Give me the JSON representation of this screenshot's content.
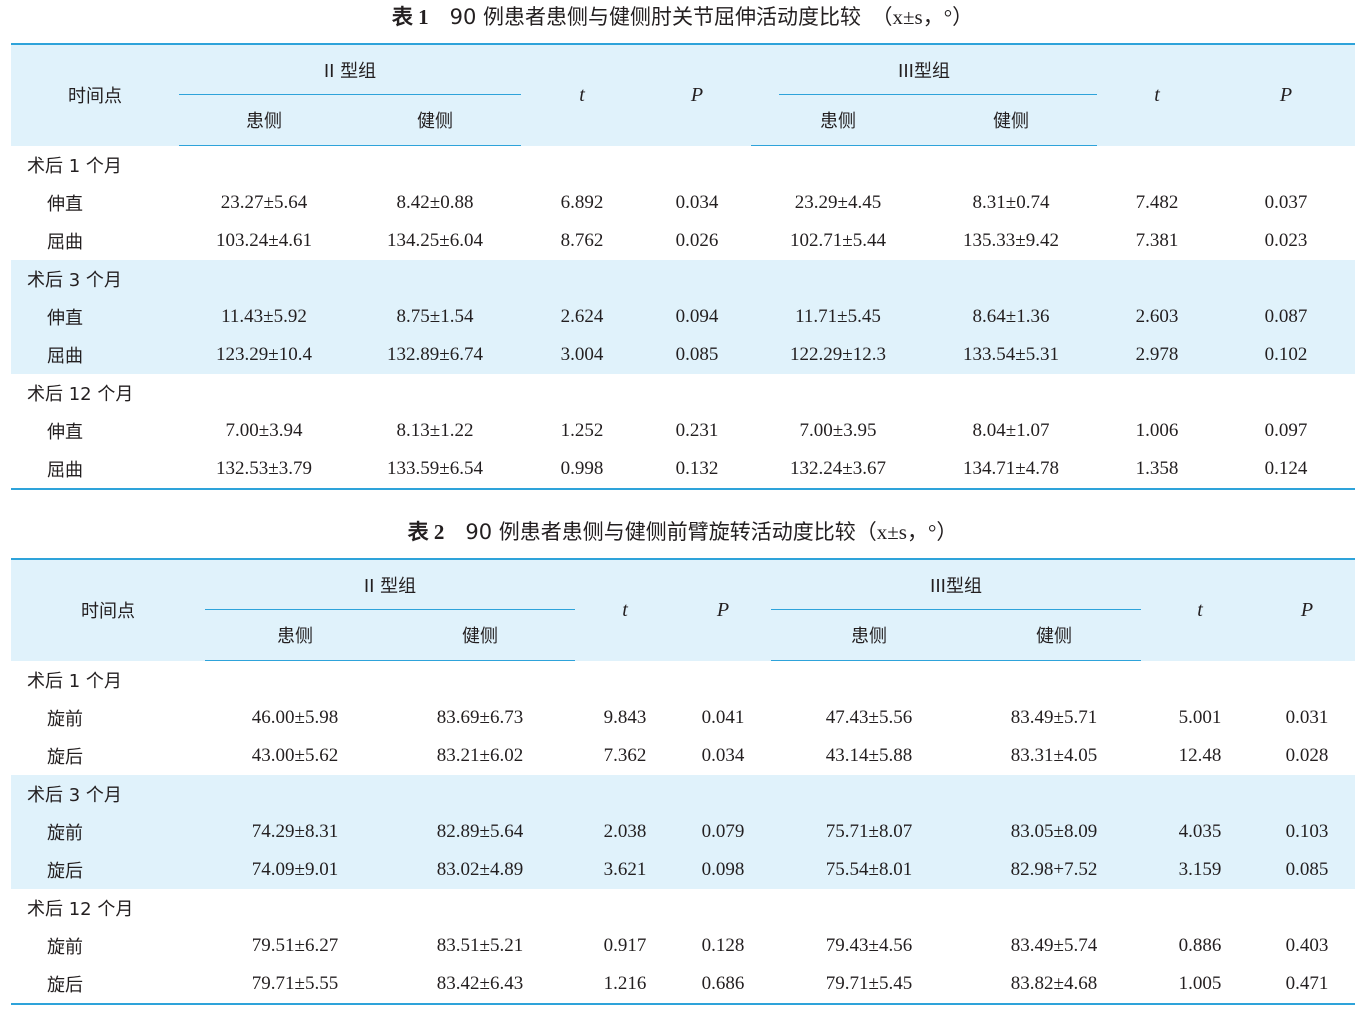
{
  "table1": {
    "caption_num": "表 1",
    "caption_title": "90 例患者患侧与健侧肘关节屈伸活动度比较",
    "caption_unit": "（x±s，°）",
    "header": {
      "time_point": "时间点",
      "group2": "II 型组",
      "group3": "III型组",
      "affected": "患侧",
      "healthy": "健侧",
      "t": "t",
      "p": "P"
    },
    "sections": [
      {
        "label": "术后 1 个月",
        "rows": [
          {
            "label": "伸直",
            "values": [
              "23.27±5.64",
              "8.42±0.88",
              "6.892",
              "0.034",
              "23.29±4.45",
              "8.31±0.74",
              "7.482",
              "0.037"
            ]
          },
          {
            "label": "屈曲",
            "values": [
              "103.24±4.61",
              "134.25±6.04",
              "8.762",
              "0.026",
              "102.71±5.44",
              "135.33±9.42",
              "7.381",
              "0.023"
            ]
          }
        ]
      },
      {
        "label": "术后 3 个月",
        "rows": [
          {
            "label": "伸直",
            "values": [
              "11.43±5.92",
              "8.75±1.54",
              "2.624",
              "0.094",
              "11.71±5.45",
              "8.64±1.36",
              "2.603",
              "0.087"
            ]
          },
          {
            "label": "屈曲",
            "values": [
              "123.29±10.4",
              "132.89±6.74",
              "3.004",
              "0.085",
              "122.29±12.3",
              "133.54±5.31",
              "2.978",
              "0.102"
            ]
          }
        ]
      },
      {
        "label": "术后 12 个月",
        "rows": [
          {
            "label": "伸直",
            "values": [
              "7.00±3.94",
              "8.13±1.22",
              "1.252",
              "0.231",
              "7.00±3.95",
              "8.04±1.07",
              "1.006",
              "0.097"
            ]
          },
          {
            "label": "屈曲",
            "values": [
              "132.53±3.79",
              "133.59±6.54",
              "0.998",
              "0.132",
              "132.24±3.67",
              "134.71±4.78",
              "1.358",
              "0.124"
            ]
          }
        ]
      }
    ]
  },
  "table2": {
    "caption_num": "表 2",
    "caption_title": "90 例患者患侧与健侧前臂旋转活动度比较",
    "caption_unit": "（x±s，°）",
    "header": {
      "time_point": "时间点",
      "group2": "II 型组",
      "group3": "III型组",
      "affected": "患侧",
      "healthy": "健侧",
      "t": "t",
      "p": "P"
    },
    "sections": [
      {
        "label": "术后 1 个月",
        "rows": [
          {
            "label": "旋前",
            "values": [
              "46.00±5.98",
              "83.69±6.73",
              "9.843",
              "0.041",
              "47.43±5.56",
              "83.49±5.71",
              "5.001",
              "0.031"
            ]
          },
          {
            "label": "旋后",
            "values": [
              "43.00±5.62",
              "83.21±6.02",
              "7.362",
              "0.034",
              "43.14±5.88",
              "83.31±4.05",
              "12.48",
              "0.028"
            ]
          }
        ]
      },
      {
        "label": "术后 3 个月",
        "rows": [
          {
            "label": "旋前",
            "values": [
              "74.29±8.31",
              "82.89±5.64",
              "2.038",
              "0.079",
              "75.71±8.07",
              "83.05±8.09",
              "4.035",
              "0.103"
            ]
          },
          {
            "label": "旋后",
            "values": [
              "74.09±9.01",
              "83.02±4.89",
              "3.621",
              "0.098",
              "75.54±8.01",
              "82.98+7.52",
              "3.159",
              "0.085"
            ]
          }
        ]
      },
      {
        "label": "术后 12 个月",
        "rows": [
          {
            "label": "旋前",
            "values": [
              "79.51±6.27",
              "83.51±5.21",
              "0.917",
              "0.128",
              "79.43±4.56",
              "83.49±5.74",
              "0.886",
              "0.403"
            ]
          },
          {
            "label": "旋后",
            "values": [
              "79.71±5.55",
              "83.42±6.43",
              "1.216",
              "0.686",
              "79.71±5.45",
              "83.82±4.68",
              "1.005",
              "0.471"
            ]
          }
        ]
      }
    ]
  },
  "colors": {
    "rule": "#2ea3da",
    "band": "#e0f2fb",
    "text": "#231f20"
  }
}
